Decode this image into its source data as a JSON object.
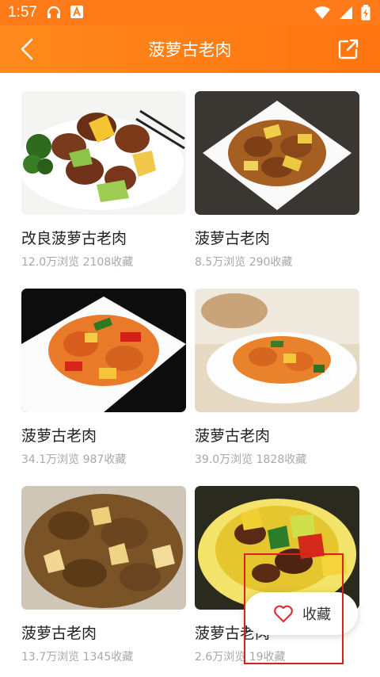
{
  "status_bar": {
    "time": "1:57"
  },
  "header": {
    "title": "菠萝古老肉"
  },
  "recipes": [
    {
      "name": "改良菠萝古老肉",
      "stats": "12.0万浏览 2108收藏"
    },
    {
      "name": "菠萝古老肉",
      "stats": "8.5万浏览 290收藏"
    },
    {
      "name": "菠萝古老肉",
      "stats": "34.1万浏览 987收藏"
    },
    {
      "name": "菠萝古老肉",
      "stats": "39.0万浏览 1828收藏"
    },
    {
      "name": "菠萝古老肉",
      "stats": "13.7万浏览 1345收藏"
    },
    {
      "name": "菠萝古老肉",
      "stats": "2.6万浏览 19收藏"
    }
  ],
  "favorite_button": {
    "label": "收藏",
    "icon": "heart-icon"
  },
  "colors": {
    "accent": "#ff7a18",
    "highlight": "#d82020"
  }
}
